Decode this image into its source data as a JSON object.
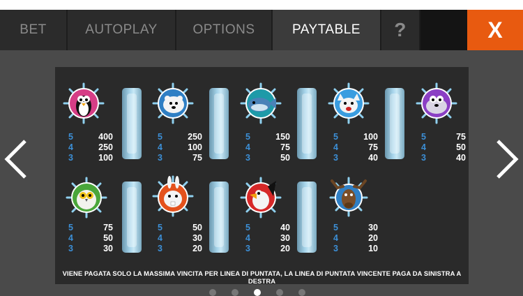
{
  "tabs": [
    {
      "label": "BET"
    },
    {
      "label": "AUTOPLAY"
    },
    {
      "label": "OPTIONS"
    },
    {
      "label": "PAYTABLE"
    },
    {
      "label": "?"
    }
  ],
  "close_label": "X",
  "active_tab": "PAYTABLE",
  "colors": {
    "accent": "#e85a10",
    "multiplier": "#3c8fd6",
    "panel": "#2a2a2a"
  },
  "symbols_row1": [
    {
      "icon": "penguin-icon",
      "pays": [
        {
          "n": "5",
          "v": "400"
        },
        {
          "n": "4",
          "v": "250"
        },
        {
          "n": "3",
          "v": "100"
        }
      ]
    },
    {
      "icon": "polar-bear-icon",
      "pays": [
        {
          "n": "5",
          "v": "250"
        },
        {
          "n": "4",
          "v": "100"
        },
        {
          "n": "3",
          "v": "75"
        }
      ]
    },
    {
      "icon": "whale-icon",
      "pays": [
        {
          "n": "5",
          "v": "150"
        },
        {
          "n": "4",
          "v": "75"
        },
        {
          "n": "3",
          "v": "50"
        }
      ]
    },
    {
      "icon": "arctic-fox-icon",
      "pays": [
        {
          "n": "5",
          "v": "100"
        },
        {
          "n": "4",
          "v": "75"
        },
        {
          "n": "3",
          "v": "40"
        }
      ]
    },
    {
      "icon": "seal-icon",
      "pays": [
        {
          "n": "5",
          "v": "75"
        },
        {
          "n": "4",
          "v": "50"
        },
        {
          "n": "3",
          "v": "40"
        }
      ]
    }
  ],
  "symbols_row2": [
    {
      "icon": "snowy-owl-icon",
      "pays": [
        {
          "n": "5",
          "v": "75"
        },
        {
          "n": "4",
          "v": "50"
        },
        {
          "n": "3",
          "v": "30"
        }
      ]
    },
    {
      "icon": "arctic-hare-icon",
      "pays": [
        {
          "n": "5",
          "v": "50"
        },
        {
          "n": "4",
          "v": "30"
        },
        {
          "n": "3",
          "v": "20"
        }
      ]
    },
    {
      "icon": "puffin-icon",
      "pays": [
        {
          "n": "5",
          "v": "40"
        },
        {
          "n": "4",
          "v": "30"
        },
        {
          "n": "3",
          "v": "20"
        }
      ]
    },
    {
      "icon": "moose-icon",
      "pays": [
        {
          "n": "5",
          "v": "30"
        },
        {
          "n": "4",
          "v": "20"
        },
        {
          "n": "3",
          "v": "10"
        }
      ]
    }
  ],
  "footnote": "VIENE PAGATA SOLO LA MASSIMA VINCITA PER LINEA DI PUNTATA, LA LINEA DI PUNTATA VINCENTE PAGA DA SINISTRA A DESTRA",
  "page_count": 5,
  "current_page": 3
}
